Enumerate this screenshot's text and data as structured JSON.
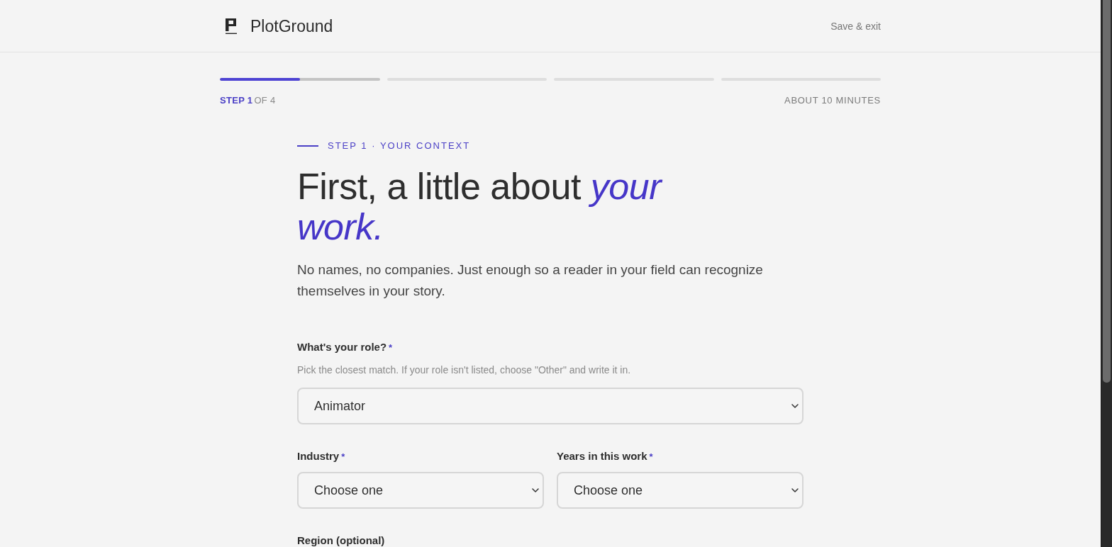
{
  "header": {
    "logo": "PlotGround",
    "action": "Save & exit"
  },
  "progress": {
    "segments": [
      {
        "current": true,
        "level": 0.5
      },
      {
        "current": false
      },
      {
        "current": false
      },
      {
        "current": false
      }
    ],
    "step_label": "STEP 1",
    "step_total": "OF 4",
    "time_estimate": "ABOUT 10 MINUTES"
  },
  "intro": {
    "eyebrow": "STEP 1 · YOUR CONTEXT",
    "heading": "First, a little about *your work.*",
    "subtitle": "No names, no companies. Just enough so a reader in your field can recognize themselves in your story."
  },
  "form": {
    "rows": [
      {
        "fields": [
          {
            "label": "What's your role?",
            "required_mark": "*",
            "hint": "Pick the closest match. If your role isn't listed, choose \"Other\" and write it in.",
            "value": "Animator"
          }
        ]
      },
      {
        "fields": [
          {
            "label": "Industry",
            "required_mark": "*",
            "placeholder": "Choose one"
          },
          {
            "label": "Years in this work",
            "required_mark": "*",
            "placeholder": "Choose one"
          }
        ]
      },
      {
        "fields": [
          {
            "label": "Region (optional)"
          }
        ]
      }
    ]
  }
}
